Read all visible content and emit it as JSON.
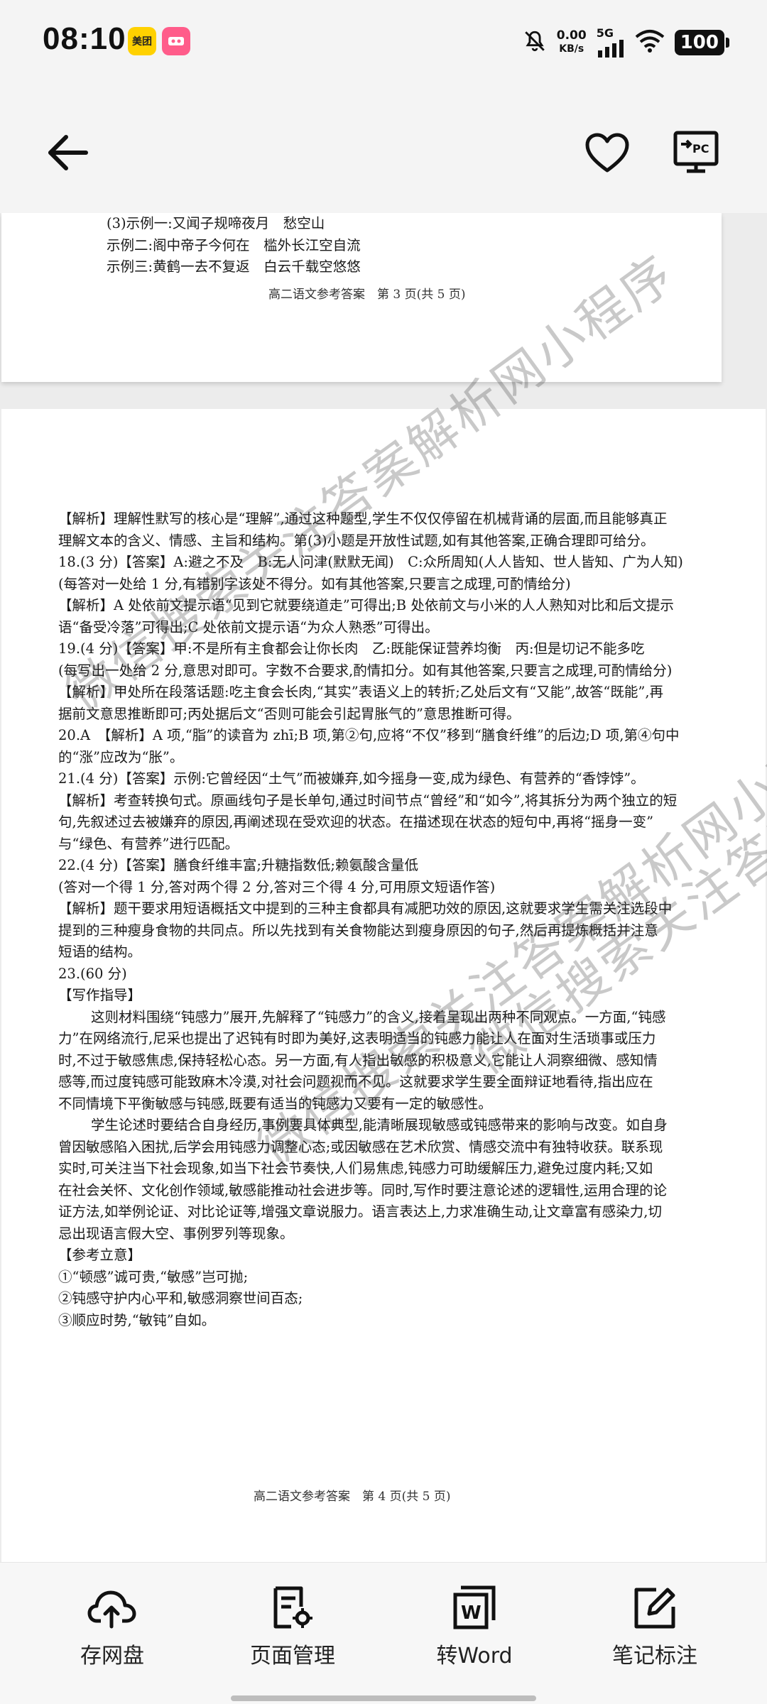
{
  "status_bar": {
    "time": "08:10",
    "app_icon_1_text": "美团",
    "net_speed_value": "0.00",
    "net_speed_unit": "KB/s",
    "network_type": "5G",
    "battery": "100"
  },
  "app_bar": {
    "back_icon": "arrow-left-icon",
    "favorite_icon": "heart-icon",
    "pc_icon": "pc-transfer-icon",
    "pc_label": "PC"
  },
  "document": {
    "prev_page": {
      "lines": [
        "(3)示例一:又闻子规啼夜月　愁空山",
        "示例二:阁中帝子今何在　槛外长江空自流",
        "示例三:黄鹤一去不复返　白云千载空悠悠"
      ],
      "footer": "高二语文参考答案　第 3 页(共 5 页)"
    },
    "current_page": {
      "lines": [
        "【解析】理解性默写的核心是“理解”,通过这种题型,学生不仅仅停留在机械背诵的层面,而且能够真正",
        "理解文本的含义、情感、主旨和结构。第(3)小题是开放性试题,如有其他答案,正确合理即可给分。",
        "18.(3 分)【答案】A:避之不及　B:无人问津(默默无闻)　C:众所周知(人人皆知、世人皆知、广为人知)",
        "(每答对一处给 1 分,有错别字该处不得分。如有其他答案,只要言之成理,可酌情给分)",
        "【解析】A 处依前文提示语“见到它就要绕道走”可得出;B 处依前文与小米的人人熟知对比和后文提示",
        "语“备受冷落”可得出;C 处依前文提示语“为众人熟悉”可得出。",
        "19.(4 分)【答案】甲:不是所有主食都会让你长肉　乙:既能保证营养均衡　丙:但是切记不能多吃",
        "(每写出一处给 2 分,意思对即可。字数不合要求,酌情扣分。如有其他答案,只要言之成理,可酌情给分)",
        "【解析】甲处所在段落话题:吃主食会长肉,“其实”表语义上的转折;乙处后文有“又能”,故答“既能”,再",
        "据前文意思推断即可;丙处据后文“否则可能会引起胃胀气的”意思推断可得。",
        "20.A　【解析】A 项,“脂”的读音为 zhī;B 项,第②句,应将“不仅”移到“膳食纤维”的后边;D 项,第④句中",
        "的“涨”应改为“胀”。",
        "21.(4 分)【答案】示例:它曾经因“土气”而被嫌弃,如今摇身一变,成为绿色、有营养的“香饽饽”。",
        "【解析】考查转换句式。原画线句子是长单句,通过时间节点“曾经”和“如今”,将其拆分为两个独立的短",
        "句,先叙述过去被嫌弃的原因,再阐述现在受欢迎的状态。在描述现在状态的短句中,再将“摇身一变”",
        "与“绿色、有营养”进行匹配。",
        "22.(4 分)【答案】膳食纤维丰富;升糖指数低;赖氨酸含量低",
        "(答对一个得 1 分,答对两个得 2 分,答对三个得 4 分,可用原文短语作答)",
        "【解析】题干要求用短语概括文中提到的三种主食都具有减肥功效的原因,这就要求学生需关注选段中",
        "提到的三种瘦身食物的共同点。所以先找到有关食物能达到瘦身原因的句子,然后再提炼概括并注意",
        "短语的结构。",
        "23.(60 分)",
        "【写作指导】",
        "这则材料围绕“钝感力”展开,先解释了“钝感力”的含义,接着呈现出两种不同观点。一方面,“钝感",
        "力”在网络流行,尼采也提出了迟钝有时即为美好,这表明适当的钝感力能让人在面对生活琐事或压力",
        "时,不过于敏感焦虑,保持轻松心态。另一方面,有人指出敏感的积极意义,它能让人洞察细微、感知情",
        "感等,而过度钝感可能致麻木冷漠,对社会问题视而不见。这就要求学生要全面辩证地看待,指出应在",
        "不同情境下平衡敏感与钝感,既要有适当的钝感力又要有一定的敏感性。",
        "学生论述时要结合自身经历,事例要具体典型,能清晰展现敏感或钝感带来的影响与改变。如自身",
        "曾因敏感陷入困扰,后学会用钝感力调整心态;或因敏感在艺术欣赏、情感交流中有独特收获。联系现",
        "实时,可关注当下社会现象,如当下社会节奏快,人们易焦虑,钝感力可助缓解压力,避免过度内耗;又如",
        "在社会关怀、文化创作领域,敏感能推动社会进步等。同时,写作时要注意论述的逻辑性,运用合理的论",
        "证方法,如举例论证、对比论证等,增强文章说服力。语言表达上,力求准确生动,让文章富有感染力,切",
        "忌出现语言假大空、事例罗列等现象。",
        "【参考立意】",
        "①“顿感”诚可贵,“敏感”岂可抛;",
        "②钝感守护内心平和,敏感洞察世间百态;",
        "③顺应时势,“敏钝”自如。"
      ],
      "footer": "高二语文参考答案　第 4 页(共 5 页)"
    },
    "watermark": "微信搜索关注答案解析网小程序"
  },
  "toolbar": {
    "items": [
      {
        "label": "存网盘",
        "icon": "cloud-upload-icon"
      },
      {
        "label": "页面管理",
        "icon": "page-settings-icon"
      },
      {
        "label": "转Word",
        "icon": "word-convert-icon"
      },
      {
        "label": "笔记标注",
        "icon": "edit-note-icon"
      }
    ],
    "word_icon_letter": "W"
  }
}
